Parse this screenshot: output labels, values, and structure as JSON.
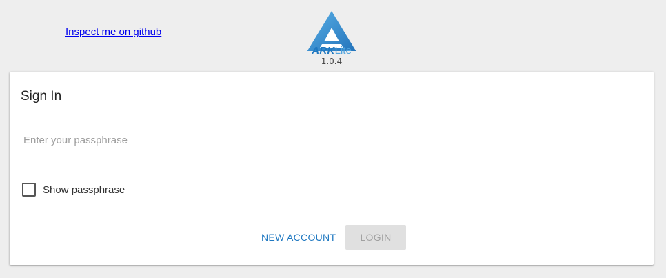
{
  "header": {
    "github_link": "Inspect me on github",
    "logo": {
      "icon": "ark-triangle-logo",
      "brand_bold": "ARK",
      "brand_light": "Lite"
    },
    "version": "1.0.4"
  },
  "signin": {
    "title": "Sign In",
    "passphrase_placeholder": "Enter your passphrase",
    "passphrase_value": "",
    "show_passphrase_label": "Show passphrase",
    "show_passphrase_checked": false,
    "new_account_label": "NEW ACCOUNT",
    "login_label": "LOGIN",
    "login_enabled": false
  },
  "colors": {
    "accent": "#1f78c1",
    "logo_light": "#4fa3dd",
    "background": "#eeeeee",
    "disabled_button": "#e0e0e0"
  }
}
